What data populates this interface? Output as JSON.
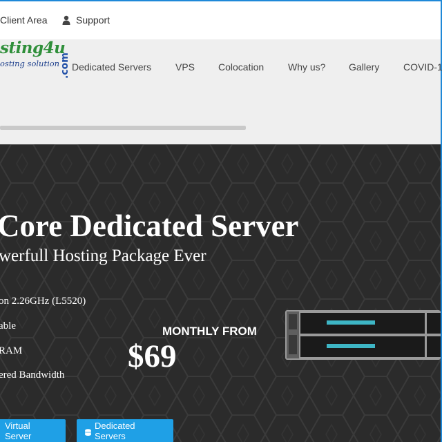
{
  "topbar": {
    "client_area": "Client Area",
    "support": "Support"
  },
  "logo": {
    "main": "sting4u",
    "tagline": "osting solution",
    "suffix": ".com"
  },
  "nav": {
    "items": [
      {
        "label": "Dedicated Servers"
      },
      {
        "label": "VPS"
      },
      {
        "label": "Colocation"
      },
      {
        "label": "Why us?"
      },
      {
        "label": "Gallery"
      },
      {
        "label": "COVID-1"
      }
    ]
  },
  "hero": {
    "title": "Core Dedicated Server",
    "subtitle": "werfull Hosting Package Ever",
    "features": [
      "on 2.26GHz (L5520)",
      "able",
      "RAM",
      "ered Bandwidth"
    ],
    "monthly_label": "MONTHLY FROM",
    "price": "$69",
    "buttons": {
      "virtual": "Virtual Server",
      "dedicated": "Dedicated Servers"
    }
  },
  "colors": {
    "accent": "#1fa0e6",
    "hero_bg": "#2b2b2b",
    "logo_green": "#2f8f3a",
    "logo_blue": "#1d3f8c"
  }
}
